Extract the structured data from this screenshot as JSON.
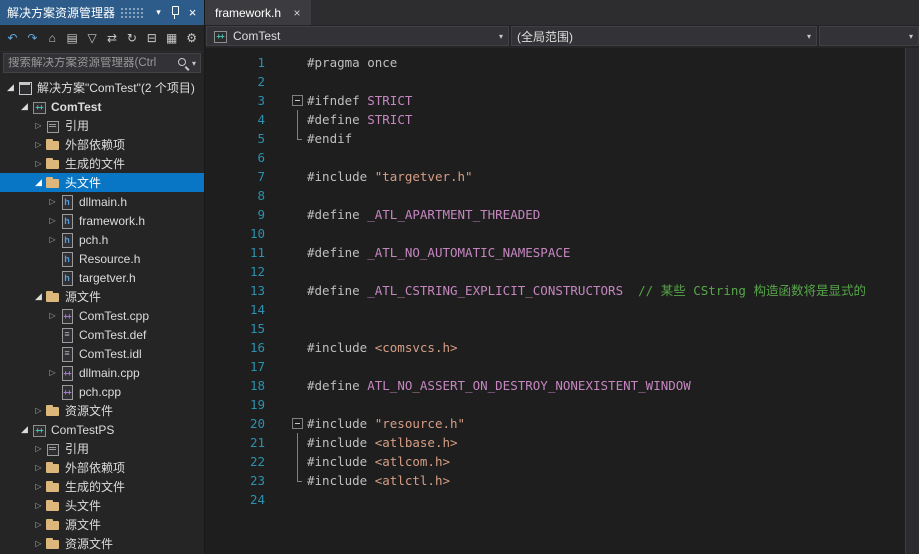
{
  "colors": {
    "titlebar_bg": "#2E5C8A",
    "selection_bg": "#0875C5",
    "editor_bg": "#1E1E1E",
    "panel_bg": "#252526",
    "line_number": "#2B91AF",
    "preprocessor": "#BFBFBF",
    "macro": "#C586C0",
    "string": "#D69D85",
    "comment": "#57A64A",
    "folder": "#DCB67A"
  },
  "solution_explorer": {
    "title": "解决方案资源管理器",
    "title_icons": [
      {
        "name": "window-position-icon",
        "glyph": "▾"
      },
      {
        "name": "pin-icon",
        "glyph": ""
      },
      {
        "name": "close-icon",
        "glyph": "×"
      }
    ],
    "toolbar": [
      {
        "name": "back-icon",
        "glyph": "↶"
      },
      {
        "name": "forward-icon",
        "glyph": "↷"
      },
      {
        "name": "home-icon",
        "glyph": "⌂"
      },
      {
        "name": "switch-views-icon",
        "glyph": "▤"
      },
      {
        "name": "pending-changes-filter-icon",
        "glyph": "▽"
      },
      {
        "name": "sync-with-active-document-icon",
        "glyph": "⇄"
      },
      {
        "name": "refresh-icon",
        "glyph": "↻"
      },
      {
        "name": "collapse-all-icon",
        "glyph": "⊟"
      },
      {
        "name": "show-all-files-icon",
        "glyph": "▦"
      },
      {
        "name": "properties-icon",
        "glyph": "⚙"
      }
    ],
    "search": {
      "placeholder": "搜索解决方案资源管理器(Ctrl"
    },
    "tree": [
      {
        "label": "解决方案\"ComTest\"(2 个项目)",
        "level": 0,
        "arrow": "exp",
        "icon": "solution-icon"
      },
      {
        "label": "ComTest",
        "level": 1,
        "arrow": "exp",
        "icon": "vcxproj-icon",
        "bold": true
      },
      {
        "label": "引用",
        "level": 2,
        "arrow": "col",
        "icon": "references-icon"
      },
      {
        "label": "外部依赖项",
        "level": 2,
        "arrow": "col",
        "icon": "folder-icon"
      },
      {
        "label": "生成的文件",
        "level": 2,
        "arrow": "col",
        "icon": "folder-icon"
      },
      {
        "label": "头文件",
        "level": 2,
        "arrow": "exp",
        "icon": "folder-icon",
        "selected": true
      },
      {
        "label": "dllmain.h",
        "level": 3,
        "arrow": "col",
        "icon": "header-file-icon"
      },
      {
        "label": "framework.h",
        "level": 3,
        "arrow": "col",
        "icon": "header-file-icon"
      },
      {
        "label": "pch.h",
        "level": 3,
        "arrow": "col",
        "icon": "header-file-icon"
      },
      {
        "label": "Resource.h",
        "level": 3,
        "arrow": "none",
        "icon": "header-file-icon"
      },
      {
        "label": "targetver.h",
        "level": 3,
        "arrow": "none",
        "icon": "header-file-icon"
      },
      {
        "label": "源文件",
        "level": 2,
        "arrow": "exp",
        "icon": "folder-icon"
      },
      {
        "label": "ComTest.cpp",
        "level": 3,
        "arrow": "col",
        "icon": "cpp-file-icon"
      },
      {
        "label": "ComTest.def",
        "level": 3,
        "arrow": "none",
        "icon": "def-file-icon"
      },
      {
        "label": "ComTest.idl",
        "level": 3,
        "arrow": "none",
        "icon": "idl-file-icon"
      },
      {
        "label": "dllmain.cpp",
        "level": 3,
        "arrow": "col",
        "icon": "cpp-file-icon"
      },
      {
        "label": "pch.cpp",
        "level": 3,
        "arrow": "none",
        "icon": "cpp-file-icon"
      },
      {
        "label": "资源文件",
        "level": 2,
        "arrow": "col",
        "icon": "folder-icon"
      },
      {
        "label": "ComTestPS",
        "level": 1,
        "arrow": "exp",
        "icon": "vcxproj-icon"
      },
      {
        "label": "引用",
        "level": 2,
        "arrow": "col",
        "icon": "references-icon"
      },
      {
        "label": "外部依赖项",
        "level": 2,
        "arrow": "col",
        "icon": "folder-icon"
      },
      {
        "label": "生成的文件",
        "level": 2,
        "arrow": "col",
        "icon": "folder-icon"
      },
      {
        "label": "头文件",
        "level": 2,
        "arrow": "col",
        "icon": "folder-icon"
      },
      {
        "label": "源文件",
        "level": 2,
        "arrow": "col",
        "icon": "folder-icon"
      },
      {
        "label": "资源文件",
        "level": 2,
        "arrow": "col",
        "icon": "folder-icon"
      }
    ]
  },
  "editor": {
    "tab": {
      "label": "framework.h",
      "close_glyph": "×"
    },
    "navbar": {
      "project_selector": "ComTest",
      "scope_selector": "(全局范围)",
      "dropdown_glyph": "▾"
    },
    "lines": [
      {
        "n": 1,
        "f": "",
        "s": [
          [
            "pp",
            "#pragma once"
          ]
        ]
      },
      {
        "n": 2,
        "f": "",
        "s": []
      },
      {
        "n": 3,
        "f": "b",
        "s": [
          [
            "pp",
            "#ifndef "
          ],
          [
            "mac",
            "STRICT"
          ]
        ]
      },
      {
        "n": 4,
        "f": "l",
        "s": [
          [
            "pp",
            "#define "
          ],
          [
            "mac",
            "STRICT"
          ]
        ]
      },
      {
        "n": 5,
        "f": "e",
        "s": [
          [
            "pp",
            "#endif"
          ]
        ]
      },
      {
        "n": 6,
        "f": "",
        "s": []
      },
      {
        "n": 7,
        "f": "",
        "s": [
          [
            "pp",
            "#include "
          ],
          [
            "str",
            "\"targetver.h\""
          ]
        ]
      },
      {
        "n": 8,
        "f": "",
        "s": []
      },
      {
        "n": 9,
        "f": "",
        "s": [
          [
            "pp",
            "#define "
          ],
          [
            "mac",
            "_ATL_APARTMENT_THREADED"
          ]
        ]
      },
      {
        "n": 10,
        "f": "",
        "s": []
      },
      {
        "n": 11,
        "f": "",
        "s": [
          [
            "pp",
            "#define "
          ],
          [
            "mac",
            "_ATL_NO_AUTOMATIC_NAMESPACE"
          ]
        ]
      },
      {
        "n": 12,
        "f": "",
        "s": []
      },
      {
        "n": 13,
        "f": "",
        "s": [
          [
            "pp",
            "#define "
          ],
          [
            "mac",
            "_ATL_CSTRING_EXPLICIT_CONSTRUCTORS"
          ],
          [
            "com",
            "  // 某些 CString 构造函数将是显式的"
          ]
        ]
      },
      {
        "n": 14,
        "f": "",
        "s": []
      },
      {
        "n": 15,
        "f": "",
        "s": []
      },
      {
        "n": 16,
        "f": "",
        "s": [
          [
            "pp",
            "#include "
          ],
          [
            "str",
            "<comsvcs.h>"
          ]
        ]
      },
      {
        "n": 17,
        "f": "",
        "s": []
      },
      {
        "n": 18,
        "f": "",
        "s": [
          [
            "pp",
            "#define "
          ],
          [
            "mac",
            "ATL_NO_ASSERT_ON_DESTROY_NONEXISTENT_WINDOW"
          ]
        ]
      },
      {
        "n": 19,
        "f": "",
        "s": []
      },
      {
        "n": 20,
        "f": "b",
        "s": [
          [
            "pp",
            "#include "
          ],
          [
            "str",
            "\"resource.h\""
          ]
        ]
      },
      {
        "n": 21,
        "f": "l",
        "s": [
          [
            "pp",
            "#include "
          ],
          [
            "str",
            "<atlbase.h>"
          ]
        ]
      },
      {
        "n": 22,
        "f": "l",
        "s": [
          [
            "pp",
            "#include "
          ],
          [
            "str",
            "<atlcom.h>"
          ]
        ]
      },
      {
        "n": 23,
        "f": "e",
        "s": [
          [
            "pp",
            "#include "
          ],
          [
            "str",
            "<atlctl.h>"
          ]
        ]
      },
      {
        "n": 24,
        "f": "",
        "s": []
      }
    ]
  }
}
